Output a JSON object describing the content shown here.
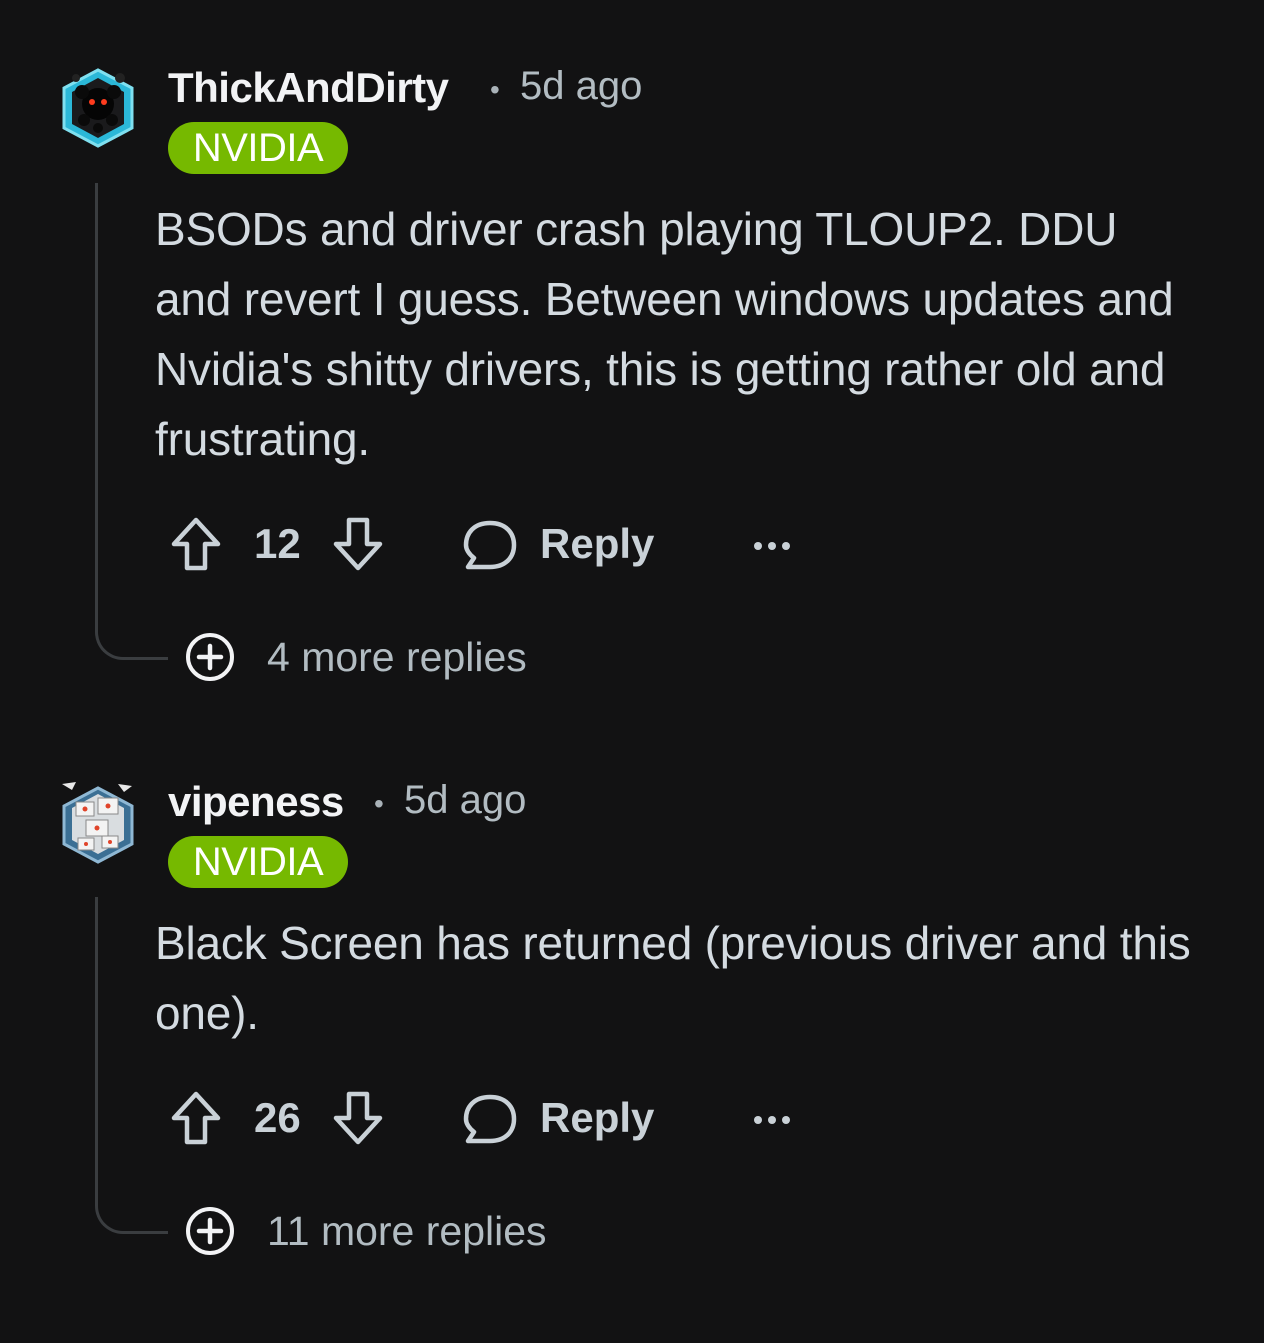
{
  "comments": [
    {
      "username": "ThickAndDirty",
      "separator": "•",
      "time": "5d ago",
      "flair": "NVIDIA",
      "flair_color": "#76b900",
      "avatar_icon": "snoo-avatar-icon",
      "body": "BSODs and driver crash playing TLOUP2. DDU and revert I guess. Between windows updates and Nvidia's shitty drivers, this is getting rather old and frustrating.",
      "score": "12",
      "reply_label": "Reply",
      "more_replies": "4 more replies"
    },
    {
      "username": "vipeness",
      "separator": "•",
      "time": "5d ago",
      "flair": "NVIDIA",
      "flair_color": "#76b900",
      "avatar_icon": "snoo-avatar-icon",
      "body": "Black Screen has returned (previous driver and this one).",
      "score": "26",
      "reply_label": "Reply",
      "more_replies": "11 more replies"
    }
  ],
  "colors": {
    "background": "#121213",
    "flair": "#76b900",
    "text": "#d4dbe1",
    "meta": "#b2bcc2"
  }
}
